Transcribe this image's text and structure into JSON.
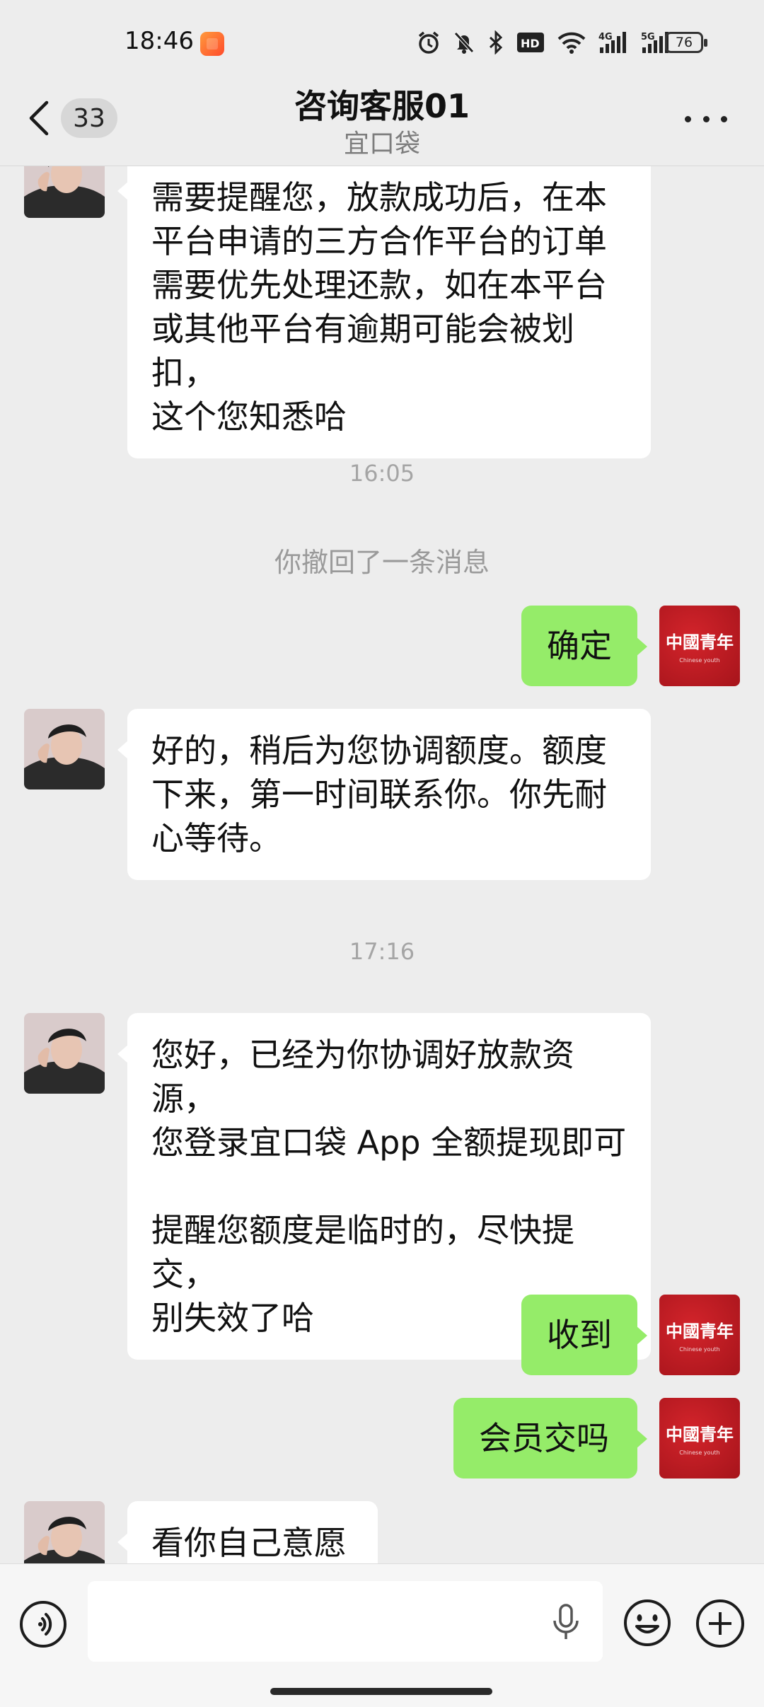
{
  "status_bar": {
    "time": "18:46",
    "battery": "76",
    "network_left": "4G",
    "network_right": "5G",
    "hd_label": "HD"
  },
  "header": {
    "back_count": "33",
    "title": "咨询客服01",
    "subtitle": "宜口袋"
  },
  "chat": {
    "messages": [
      {
        "side": "in",
        "text": "需要提醒您，放款成功后，在本\n平台申请的三方合作平台的订单\n需要优先处理还款，如在本平台\n或其他平台有逾期可能会被划扣，\n这个您知悉哈"
      },
      {
        "type": "time",
        "text": "16:05"
      },
      {
        "type": "system",
        "text": "你撤回了一条消息"
      },
      {
        "side": "out",
        "text": "确定"
      },
      {
        "side": "in",
        "text": "好的，稍后为您协调额度。额度\n下来，第一时间联系你。你先耐\n心等待。"
      },
      {
        "type": "time",
        "text": "17:16"
      },
      {
        "side": "in",
        "text": "您好，已经为你协调好放款资源，\n您登录宜口袋 App 全额提现即可\n\n提醒您额度是临时的，尽快提交，\n别失效了哈"
      },
      {
        "side": "out",
        "text": "收到"
      },
      {
        "side": "out",
        "text": "会员交吗"
      },
      {
        "side": "in",
        "text": "看你自己意愿"
      }
    ]
  },
  "self_avatar": {
    "title": "中國青年",
    "caption": "Chinese youth"
  },
  "input": {
    "placeholder": ""
  },
  "colors": {
    "outgoing_bubble": "#95ec69",
    "incoming_bubble": "#ffffff",
    "background": "#ededed"
  }
}
